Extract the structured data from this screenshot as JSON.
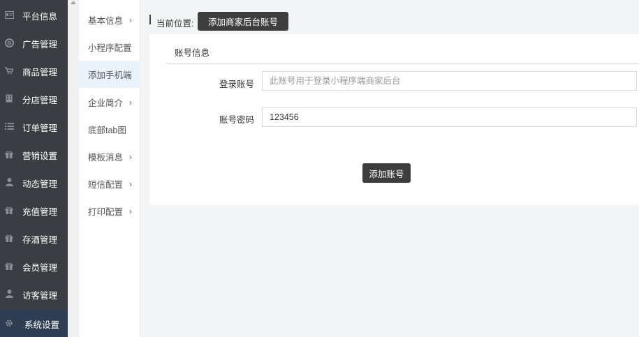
{
  "sidebar": {
    "items": [
      {
        "label": "平台信息",
        "icon": "id-card-icon"
      },
      {
        "label": "广告管理",
        "icon": "lifebuoy-icon"
      },
      {
        "label": "商品管理",
        "icon": "cart-icon"
      },
      {
        "label": "分店管理",
        "icon": "building-icon"
      },
      {
        "label": "订单管理",
        "icon": "list-icon"
      },
      {
        "label": "营销设置",
        "icon": "gift-icon"
      },
      {
        "label": "动态管理",
        "icon": "user-icon"
      },
      {
        "label": "充值管理",
        "icon": "gift-icon"
      },
      {
        "label": "存酒管理",
        "icon": "gift-icon"
      },
      {
        "label": "会员管理",
        "icon": "gift-icon"
      },
      {
        "label": "访客管理",
        "icon": "user-icon"
      },
      {
        "label": "系统设置",
        "icon": "gear-icon"
      }
    ],
    "active_index": 11,
    "accent_color": "#2e3d52",
    "background_color": "#3a3d42"
  },
  "submenu": {
    "items": [
      {
        "label": "基本信息",
        "has_chevron": true
      },
      {
        "label": "小程序配置",
        "has_chevron": false
      },
      {
        "label": "添加手机端",
        "has_chevron": false
      },
      {
        "label": "企业简介",
        "has_chevron": true
      },
      {
        "label": "底部tab图",
        "has_chevron": false
      },
      {
        "label": "模板消息",
        "has_chevron": true
      },
      {
        "label": "短信配置",
        "has_chevron": true
      },
      {
        "label": "打印配置",
        "has_chevron": true
      }
    ],
    "active_index": 2,
    "chevron": "›"
  },
  "breadcrumb": {
    "label": "当前位置:",
    "current": "添加商家后台账号"
  },
  "form": {
    "section_title": "账号信息",
    "account": {
      "label": "登录账号",
      "value": "",
      "placeholder": "此账号用于登录小程序端商家后台"
    },
    "password": {
      "label": "账号密码",
      "value": "123456",
      "placeholder": ""
    },
    "submit_label": "添加账号"
  }
}
